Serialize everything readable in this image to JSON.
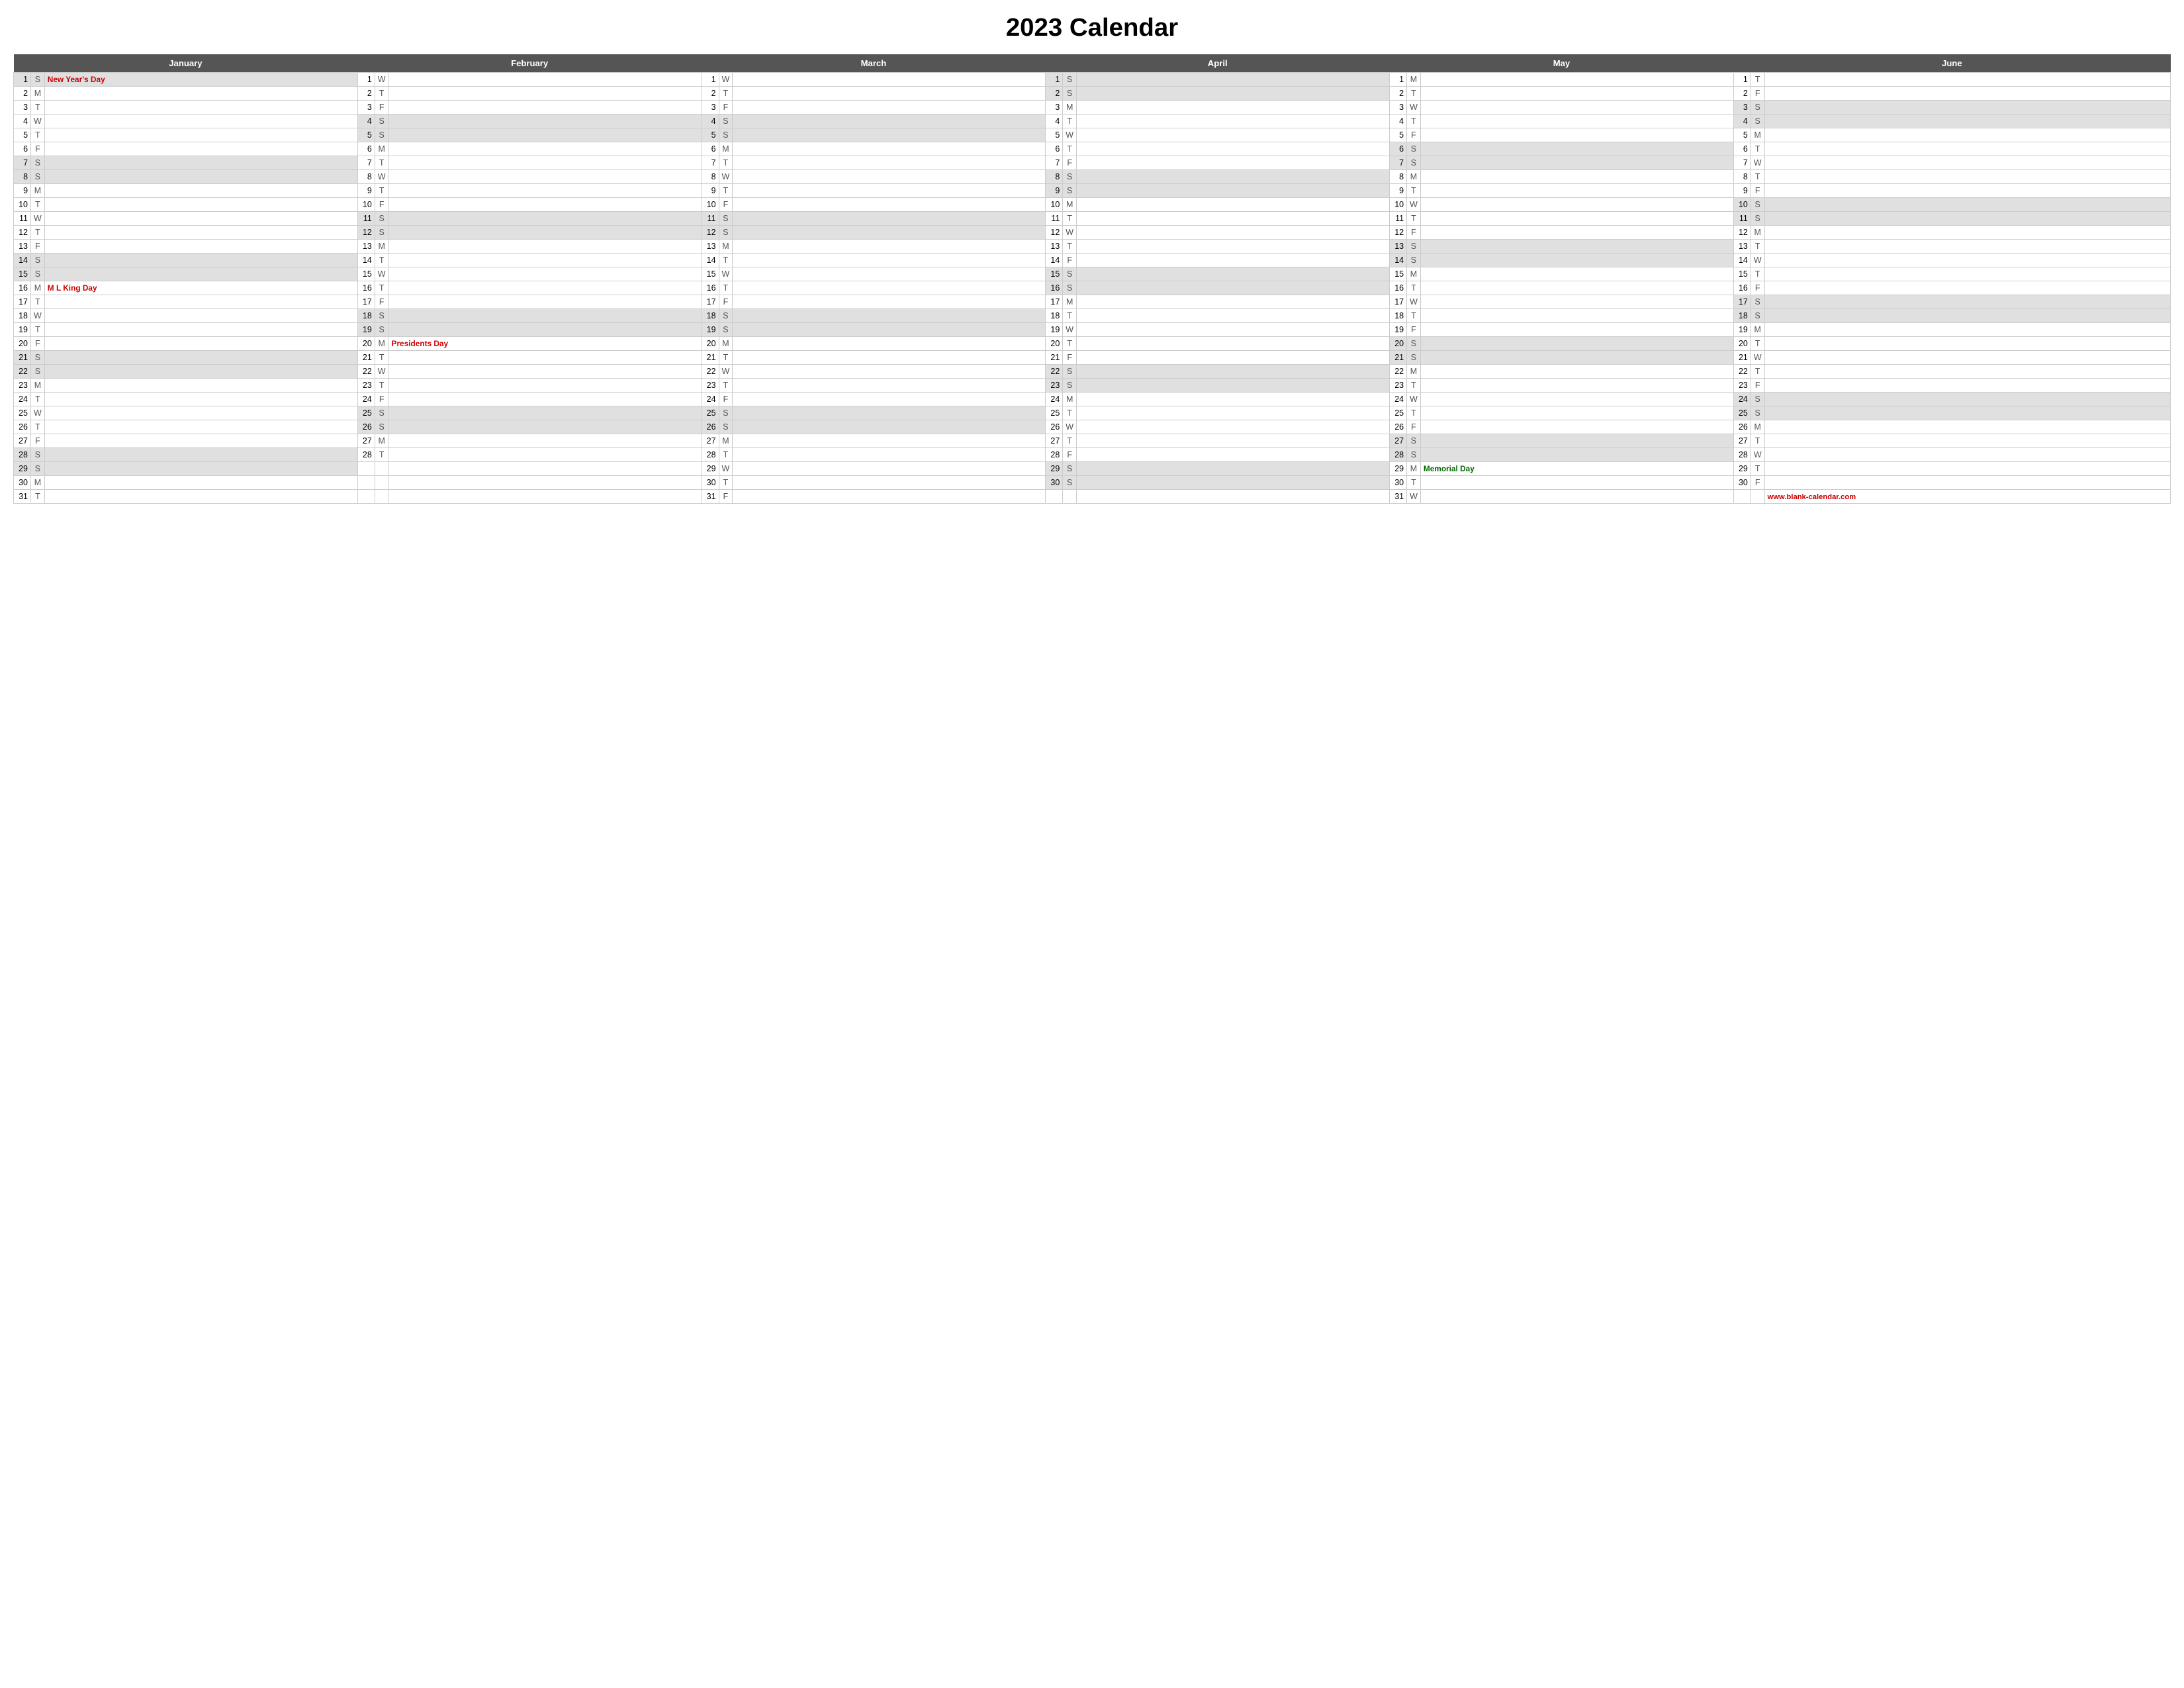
{
  "title": "2023 Calendar",
  "website": "www.blank-calendar.com",
  "months": [
    {
      "name": "January",
      "days": [
        {
          "d": 1,
          "w": "S",
          "holiday": "New Year's Day",
          "holiday_class": "holiday"
        },
        {
          "d": 2,
          "w": "M"
        },
        {
          "d": 3,
          "w": "T"
        },
        {
          "d": 4,
          "w": "W"
        },
        {
          "d": 5,
          "w": "T"
        },
        {
          "d": 6,
          "w": "F"
        },
        {
          "d": 7,
          "w": "S"
        },
        {
          "d": 8,
          "w": "S"
        },
        {
          "d": 9,
          "w": "M"
        },
        {
          "d": 10,
          "w": "T"
        },
        {
          "d": 11,
          "w": "W"
        },
        {
          "d": 12,
          "w": "T"
        },
        {
          "d": 13,
          "w": "F"
        },
        {
          "d": 14,
          "w": "S"
        },
        {
          "d": 15,
          "w": "S"
        },
        {
          "d": 16,
          "w": "M",
          "holiday": "M L King Day",
          "holiday_class": "holiday"
        },
        {
          "d": 17,
          "w": "T"
        },
        {
          "d": 18,
          "w": "W"
        },
        {
          "d": 19,
          "w": "T"
        },
        {
          "d": 20,
          "w": "F"
        },
        {
          "d": 21,
          "w": "S"
        },
        {
          "d": 22,
          "w": "S"
        },
        {
          "d": 23,
          "w": "M"
        },
        {
          "d": 24,
          "w": "T"
        },
        {
          "d": 25,
          "w": "W"
        },
        {
          "d": 26,
          "w": "T"
        },
        {
          "d": 27,
          "w": "F"
        },
        {
          "d": 28,
          "w": "S"
        },
        {
          "d": 29,
          "w": "S"
        },
        {
          "d": 30,
          "w": "M"
        },
        {
          "d": 31,
          "w": "T"
        }
      ]
    },
    {
      "name": "February",
      "days": [
        {
          "d": 1,
          "w": "W"
        },
        {
          "d": 2,
          "w": "T"
        },
        {
          "d": 3,
          "w": "F"
        },
        {
          "d": 4,
          "w": "S"
        },
        {
          "d": 5,
          "w": "S"
        },
        {
          "d": 6,
          "w": "M"
        },
        {
          "d": 7,
          "w": "T"
        },
        {
          "d": 8,
          "w": "W"
        },
        {
          "d": 9,
          "w": "T"
        },
        {
          "d": 10,
          "w": "F"
        },
        {
          "d": 11,
          "w": "S"
        },
        {
          "d": 12,
          "w": "S"
        },
        {
          "d": 13,
          "w": "M"
        },
        {
          "d": 14,
          "w": "T"
        },
        {
          "d": 15,
          "w": "W"
        },
        {
          "d": 16,
          "w": "T"
        },
        {
          "d": 17,
          "w": "F"
        },
        {
          "d": 18,
          "w": "S"
        },
        {
          "d": 19,
          "w": "S"
        },
        {
          "d": 20,
          "w": "M",
          "holiday": "Presidents Day",
          "holiday_class": "holiday"
        },
        {
          "d": 21,
          "w": "T"
        },
        {
          "d": 22,
          "w": "W"
        },
        {
          "d": 23,
          "w": "T"
        },
        {
          "d": 24,
          "w": "F"
        },
        {
          "d": 25,
          "w": "S"
        },
        {
          "d": 26,
          "w": "S"
        },
        {
          "d": 27,
          "w": "M"
        },
        {
          "d": 28,
          "w": "T"
        },
        null,
        null,
        null
      ]
    },
    {
      "name": "March",
      "days": [
        {
          "d": 1,
          "w": "W"
        },
        {
          "d": 2,
          "w": "T"
        },
        {
          "d": 3,
          "w": "F"
        },
        {
          "d": 4,
          "w": "S"
        },
        {
          "d": 5,
          "w": "S"
        },
        {
          "d": 6,
          "w": "M"
        },
        {
          "d": 7,
          "w": "T"
        },
        {
          "d": 8,
          "w": "W"
        },
        {
          "d": 9,
          "w": "T"
        },
        {
          "d": 10,
          "w": "F"
        },
        {
          "d": 11,
          "w": "S"
        },
        {
          "d": 12,
          "w": "S"
        },
        {
          "d": 13,
          "w": "M"
        },
        {
          "d": 14,
          "w": "T"
        },
        {
          "d": 15,
          "w": "W"
        },
        {
          "d": 16,
          "w": "T"
        },
        {
          "d": 17,
          "w": "F"
        },
        {
          "d": 18,
          "w": "S"
        },
        {
          "d": 19,
          "w": "S"
        },
        {
          "d": 20,
          "w": "M"
        },
        {
          "d": 21,
          "w": "T"
        },
        {
          "d": 22,
          "w": "W"
        },
        {
          "d": 23,
          "w": "T"
        },
        {
          "d": 24,
          "w": "F"
        },
        {
          "d": 25,
          "w": "S"
        },
        {
          "d": 26,
          "w": "S"
        },
        {
          "d": 27,
          "w": "M"
        },
        {
          "d": 28,
          "w": "T"
        },
        {
          "d": 29,
          "w": "W"
        },
        {
          "d": 30,
          "w": "T"
        },
        {
          "d": 31,
          "w": "F"
        }
      ]
    },
    {
      "name": "April",
      "days": [
        {
          "d": 1,
          "w": "S"
        },
        {
          "d": 2,
          "w": "S"
        },
        {
          "d": 3,
          "w": "M"
        },
        {
          "d": 4,
          "w": "T"
        },
        {
          "d": 5,
          "w": "W"
        },
        {
          "d": 6,
          "w": "T"
        },
        {
          "d": 7,
          "w": "F"
        },
        {
          "d": 8,
          "w": "S"
        },
        {
          "d": 9,
          "w": "S"
        },
        {
          "d": 10,
          "w": "M"
        },
        {
          "d": 11,
          "w": "T"
        },
        {
          "d": 12,
          "w": "W"
        },
        {
          "d": 13,
          "w": "T"
        },
        {
          "d": 14,
          "w": "F"
        },
        {
          "d": 15,
          "w": "S"
        },
        {
          "d": 16,
          "w": "S"
        },
        {
          "d": 17,
          "w": "M"
        },
        {
          "d": 18,
          "w": "T"
        },
        {
          "d": 19,
          "w": "W"
        },
        {
          "d": 20,
          "w": "T"
        },
        {
          "d": 21,
          "w": "F"
        },
        {
          "d": 22,
          "w": "S"
        },
        {
          "d": 23,
          "w": "S"
        },
        {
          "d": 24,
          "w": "M"
        },
        {
          "d": 25,
          "w": "T"
        },
        {
          "d": 26,
          "w": "W"
        },
        {
          "d": 27,
          "w": "T"
        },
        {
          "d": 28,
          "w": "F"
        },
        {
          "d": 29,
          "w": "S"
        },
        {
          "d": 30,
          "w": "S"
        },
        null
      ]
    },
    {
      "name": "May",
      "days": [
        {
          "d": 1,
          "w": "M"
        },
        {
          "d": 2,
          "w": "T"
        },
        {
          "d": 3,
          "w": "W"
        },
        {
          "d": 4,
          "w": "T"
        },
        {
          "d": 5,
          "w": "F"
        },
        {
          "d": 6,
          "w": "S"
        },
        {
          "d": 7,
          "w": "S"
        },
        {
          "d": 8,
          "w": "M"
        },
        {
          "d": 9,
          "w": "T"
        },
        {
          "d": 10,
          "w": "W"
        },
        {
          "d": 11,
          "w": "T"
        },
        {
          "d": 12,
          "w": "F"
        },
        {
          "d": 13,
          "w": "S"
        },
        {
          "d": 14,
          "w": "S"
        },
        {
          "d": 15,
          "w": "M"
        },
        {
          "d": 16,
          "w": "T"
        },
        {
          "d": 17,
          "w": "W"
        },
        {
          "d": 18,
          "w": "T"
        },
        {
          "d": 19,
          "w": "F"
        },
        {
          "d": 20,
          "w": "S"
        },
        {
          "d": 21,
          "w": "S"
        },
        {
          "d": 22,
          "w": "M"
        },
        {
          "d": 23,
          "w": "T"
        },
        {
          "d": 24,
          "w": "W"
        },
        {
          "d": 25,
          "w": "T"
        },
        {
          "d": 26,
          "w": "F"
        },
        {
          "d": 27,
          "w": "S"
        },
        {
          "d": 28,
          "w": "S"
        },
        {
          "d": 29,
          "w": "M",
          "holiday": "Memorial Day",
          "holiday_class": "holiday_green"
        },
        {
          "d": 30,
          "w": "T"
        },
        {
          "d": 31,
          "w": "W"
        }
      ]
    },
    {
      "name": "June",
      "days": [
        {
          "d": 1,
          "w": "T"
        },
        {
          "d": 2,
          "w": "F"
        },
        {
          "d": 3,
          "w": "S"
        },
        {
          "d": 4,
          "w": "S"
        },
        {
          "d": 5,
          "w": "M"
        },
        {
          "d": 6,
          "w": "T"
        },
        {
          "d": 7,
          "w": "W"
        },
        {
          "d": 8,
          "w": "T"
        },
        {
          "d": 9,
          "w": "F"
        },
        {
          "d": 10,
          "w": "S"
        },
        {
          "d": 11,
          "w": "S"
        },
        {
          "d": 12,
          "w": "M"
        },
        {
          "d": 13,
          "w": "T"
        },
        {
          "d": 14,
          "w": "W"
        },
        {
          "d": 15,
          "w": "T"
        },
        {
          "d": 16,
          "w": "F"
        },
        {
          "d": 17,
          "w": "S"
        },
        {
          "d": 18,
          "w": "S"
        },
        {
          "d": 19,
          "w": "M"
        },
        {
          "d": 20,
          "w": "T"
        },
        {
          "d": 21,
          "w": "W"
        },
        {
          "d": 22,
          "w": "T"
        },
        {
          "d": 23,
          "w": "F"
        },
        {
          "d": 24,
          "w": "S"
        },
        {
          "d": 25,
          "w": "S"
        },
        {
          "d": 26,
          "w": "M"
        },
        {
          "d": 27,
          "w": "T"
        },
        {
          "d": 28,
          "w": "W"
        },
        {
          "d": 29,
          "w": "T"
        },
        {
          "d": 30,
          "w": "F"
        },
        null
      ]
    }
  ]
}
